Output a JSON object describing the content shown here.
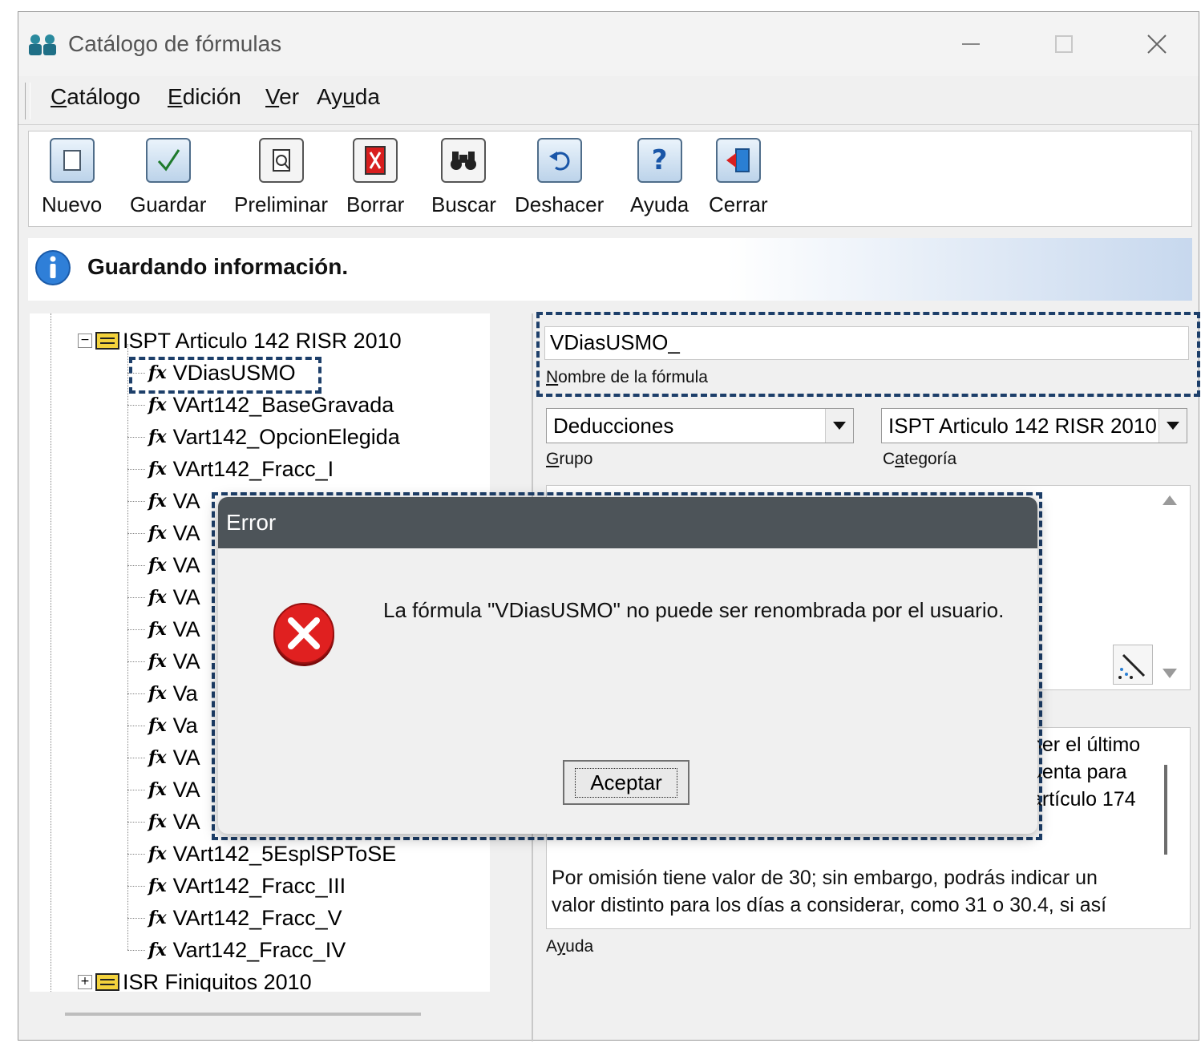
{
  "window": {
    "title": "Catálogo de fórmulas",
    "controls": [
      "minimize-icon",
      "maximize-icon",
      "close-icon"
    ]
  },
  "menu": [
    {
      "pre": "",
      "u": "C",
      "post": "atálogo"
    },
    {
      "pre": "",
      "u": "E",
      "post": "dición"
    },
    {
      "pre": "",
      "u": "V",
      "post": "er"
    },
    {
      "pre": "Ay",
      "u": "u",
      "post": "da"
    }
  ],
  "toolbar": {
    "nuevo": "Nuevo",
    "guardar": "Guardar",
    "preliminar": "Preliminar",
    "borrar": "Borrar",
    "buscar": "Buscar",
    "deshacer": "Deshacer",
    "ayuda": "Ayuda",
    "cerrar": "Cerrar"
  },
  "status": {
    "text": "Guardando información."
  },
  "tree": {
    "group1": "ISPT Articulo 142 RISR 2010",
    "items": [
      "VDiasUSMO",
      "VArt142_BaseGravada",
      "Vart142_OpcionElegida",
      "VArt142_Fracc_I",
      "VA",
      "VA",
      "VA",
      "VA",
      "VA",
      "VA",
      "Va",
      "Va",
      "VA",
      "VA",
      "VA",
      "VArt142_5EsplSPToSE",
      "VArt142_Fracc_III",
      "VArt142_Fracc_V",
      "Vart142_Fracc_IV"
    ],
    "group2": "ISR Finiquitos 2010"
  },
  "form": {
    "name_value": "VDiasUSMO_",
    "name_label_u": "N",
    "name_label_rest": "ombre de la fórmula",
    "grupo_value": "Deducciones",
    "grupo_label_u": "G",
    "grupo_label_rest": "rupo",
    "categoria_value": "ISPT Articulo 142 RISR 2010",
    "categoria_label_pre": "C",
    "categoria_label_u": "a",
    "categoria_label_rest": "tegoría",
    "help_partial": [
      "ner el último",
      "uenta para",
      "artículo 174"
    ],
    "help_line1": "Por omisión tiene valor de 30; sin embargo, podrás indicar un",
    "help_line2": "valor distinto para los días a considerar, como 31 o 30.4, si así",
    "ayuda_label_pre": "A",
    "ayuda_label_u": "y",
    "ayuda_label_rest": "uda"
  },
  "dialog": {
    "title": "Error",
    "message": "La fórmula \"VDiasUSMO\" no puede ser renombrada por el usuario.",
    "ok": "Aceptar"
  }
}
